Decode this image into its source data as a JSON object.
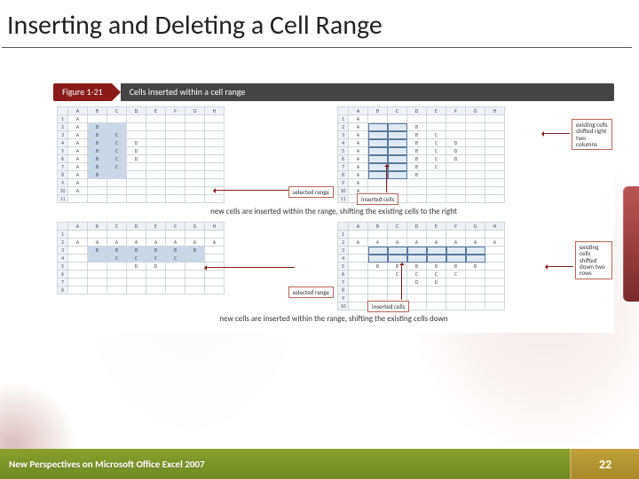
{
  "title": "Inserting and Deleting a Cell Range",
  "figure": {
    "number": "Figure 1-21",
    "title": "Cells inserted within a cell range"
  },
  "columns": [
    "A",
    "B",
    "C",
    "D",
    "E",
    "F",
    "G",
    "H"
  ],
  "rows_small": [
    "1",
    "2",
    "3",
    "4",
    "5",
    "6",
    "7",
    "8",
    "9",
    "10",
    "11"
  ],
  "quad1": {
    "A": [
      "A",
      "A",
      "A",
      "A",
      "A",
      "A",
      "A",
      "A",
      "A",
      "A"
    ],
    "B": [
      "",
      "B",
      "B",
      "B",
      "B",
      "B",
      "B",
      "B",
      "",
      ""
    ],
    "C": [
      "",
      "",
      "C",
      "C",
      "C",
      "C",
      "C",
      "",
      "",
      ""
    ],
    "D": [
      "",
      "",
      "",
      "D",
      "D",
      "D",
      "",
      "",
      "",
      ""
    ],
    "callout": "selected\nrange"
  },
  "quad2": {
    "A": [
      "A",
      "A",
      "A",
      "A",
      "A",
      "A",
      "A",
      "A",
      "A",
      "A"
    ],
    "D": [
      "",
      "B",
      "B",
      "B",
      "B",
      "B",
      "B",
      "B",
      "",
      ""
    ],
    "E": [
      "",
      "",
      "C",
      "C",
      "C",
      "C",
      "C",
      "",
      "",
      ""
    ],
    "F": [
      "",
      "",
      "",
      "D",
      "D",
      "D",
      "",
      "",
      "",
      ""
    ],
    "callout_inserted": "inserted cells",
    "callout_shift": "existing\ncells\nshifted\nright two\ncolumns"
  },
  "caption1": "new cells are inserted within the range, shifting the existing cells to the right",
  "quad3": {
    "row2": [
      "A",
      "A",
      "A",
      "A",
      "A",
      "A",
      "A",
      "A"
    ],
    "row3": [
      "",
      "B",
      "B",
      "B",
      "B",
      "B",
      "B",
      ""
    ],
    "row4": [
      "",
      "",
      "C",
      "C",
      "C",
      "C",
      "",
      ""
    ],
    "row5": [
      "",
      "",
      "",
      "D",
      "D",
      "",
      "",
      ""
    ],
    "callout": "selected\nrange"
  },
  "quad4": {
    "row2": [
      "A",
      "A",
      "A",
      "A",
      "A",
      "A",
      "A",
      "A"
    ],
    "row5": [
      "",
      "B",
      "B",
      "B",
      "B",
      "B",
      "B",
      ""
    ],
    "row6": [
      "",
      "",
      "C",
      "C",
      "C",
      "C",
      "",
      ""
    ],
    "row7": [
      "",
      "",
      "",
      "D",
      "D",
      "",
      "",
      ""
    ],
    "callout_inserted": "inserted cells",
    "callout_shift": "existing\ncells\nshifted\ndown\ntwo rows"
  },
  "caption2": "new cells are inserted within the range, shifting the existing cells down",
  "footer": {
    "left": "New Perspectives on Microsoft Office Excel 2007",
    "page": "22"
  }
}
